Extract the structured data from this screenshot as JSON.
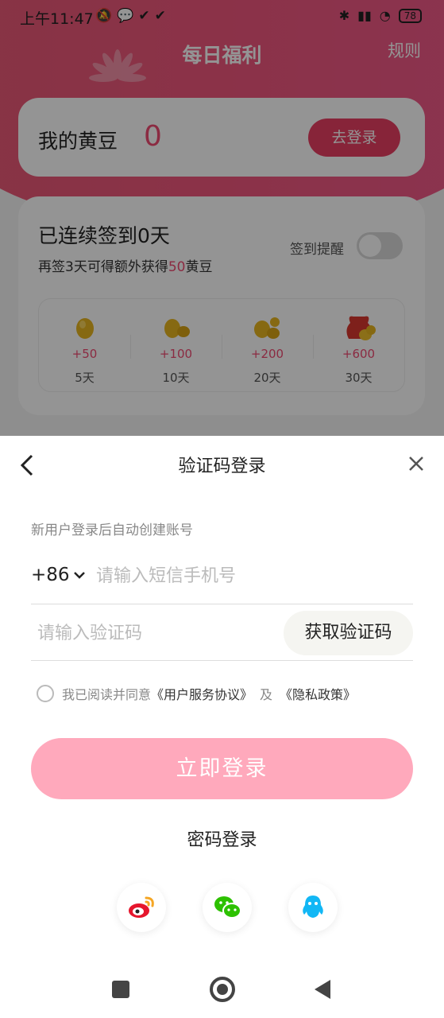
{
  "status_bar": {
    "time": "上午11:47",
    "battery": "78"
  },
  "header": {
    "title": "每日福利",
    "rules": "规则"
  },
  "beans": {
    "label": "我的黄豆",
    "value": "0",
    "login_button": "去登录"
  },
  "checkin": {
    "title": "已连续签到0天",
    "subtitle_prefix": "再签3天可得额外获得",
    "subtitle_amount": "50",
    "subtitle_suffix": "黄豆",
    "reminder_label": "签到提醒",
    "reminder_on": false,
    "rewards": [
      {
        "amount": "+50",
        "days": "5天",
        "icon": "single-bean-icon"
      },
      {
        "amount": "+100",
        "days": "10天",
        "icon": "two-beans-icon"
      },
      {
        "amount": "+200",
        "days": "20天",
        "icon": "three-beans-icon"
      },
      {
        "amount": "+600",
        "days": "30天",
        "icon": "bean-bag-icon"
      }
    ]
  },
  "login_sheet": {
    "title": "验证码登录",
    "hint": "新用户登录后自动创建账号",
    "country_code": "+86",
    "phone_placeholder": "请输入短信手机号",
    "code_placeholder": "请输入验证码",
    "get_code_button": "获取验证码",
    "agree_prefix": "我已阅读并同意",
    "agree_terms": "《用户服务协议》",
    "agree_and": "及",
    "agree_privacy": "《隐私政策》",
    "submit": "立即登录",
    "password_login": "密码登录",
    "social": [
      "weibo-icon",
      "wechat-icon",
      "qq-icon"
    ]
  },
  "colors": {
    "brand": "#ef4a72",
    "submit_disabled": "#ffa9bc"
  }
}
